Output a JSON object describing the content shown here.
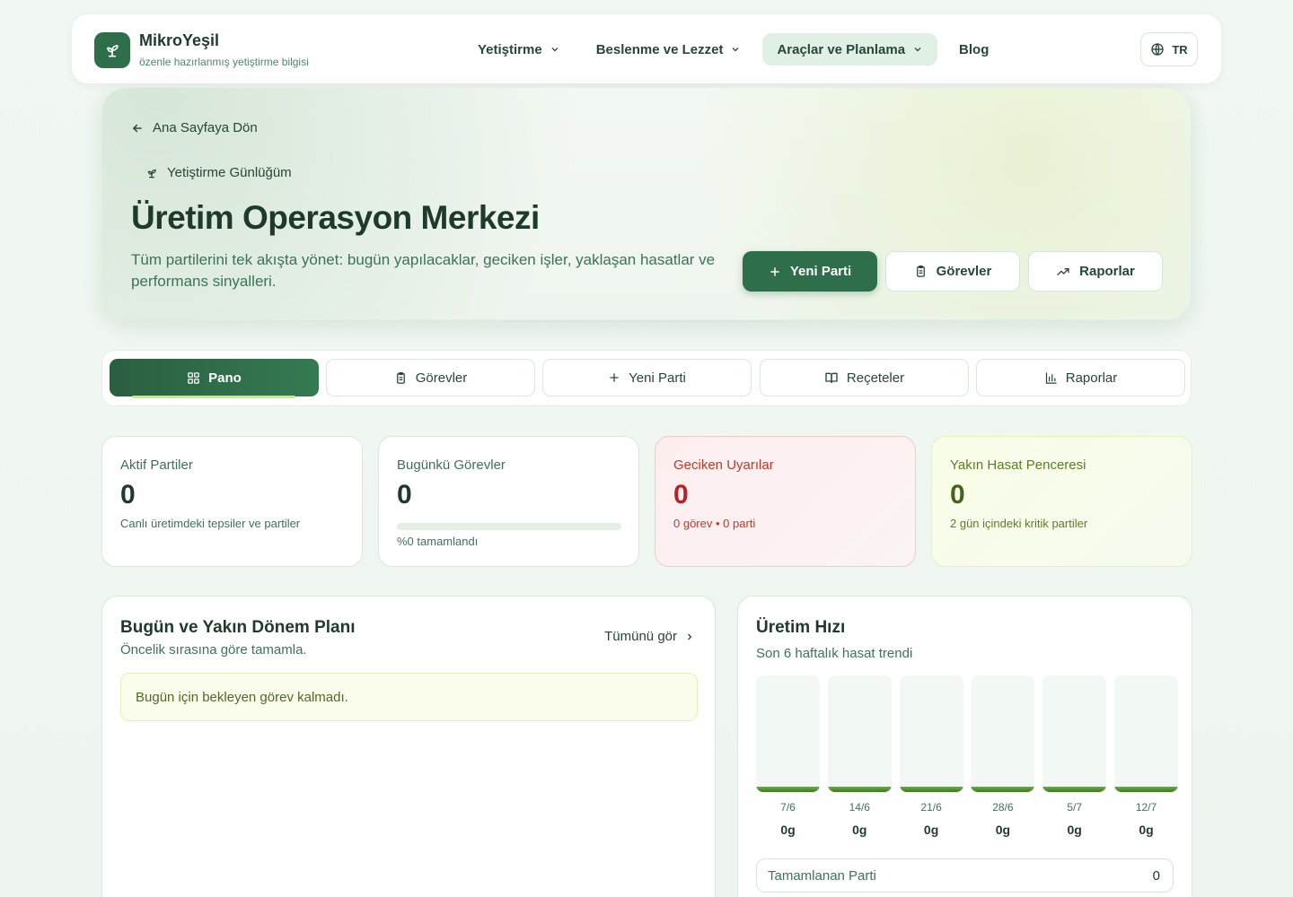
{
  "brand": {
    "name": "MikroYeşil",
    "tagline": "özenle hazırlanmış yetiştirme bilgisi"
  },
  "nav": {
    "items": [
      {
        "label": "Yetiştirme"
      },
      {
        "label": "Beslenme ve Lezzet"
      },
      {
        "label": "Araçlar ve Planlama"
      },
      {
        "label": "Blog"
      }
    ],
    "language": "TR"
  },
  "hero": {
    "back_label": "Ana Sayfaya Dön",
    "breadcrumb": "Yetiştirme Günlüğüm",
    "title": "Üretim Operasyon Merkezi",
    "description": "Tüm partilerini tek akışta yönet: bugün yapılacaklar, geciken işler, yaklaşan hasatlar ve performans sinyalleri.",
    "buttons": {
      "new_batch": "Yeni Parti",
      "tasks": "Görevler",
      "reports": "Raporlar"
    }
  },
  "tabs": [
    {
      "label": "Pano"
    },
    {
      "label": "Görevler"
    },
    {
      "label": "Yeni Parti"
    },
    {
      "label": "Reçeteler"
    },
    {
      "label": "Raporlar"
    }
  ],
  "stats": {
    "active": {
      "label": "Aktif Partiler",
      "value": "0",
      "sub": "Canlı üretimdeki tepsiler ve partiler"
    },
    "today": {
      "label": "Bugünkü Görevler",
      "value": "0",
      "sub": "%0 tamamlandı",
      "progress": 0
    },
    "overdue": {
      "label": "Geciken Uyarılar",
      "value": "0",
      "sub": "0 görev • 0 parti"
    },
    "harvest": {
      "label": "Yakın Hasat Penceresi",
      "value": "0",
      "sub": "2 gün içindeki kritik partiler"
    }
  },
  "plan": {
    "title": "Bugün ve Yakın Dönem Planı",
    "subtitle": "Öncelik sırasına göre tamamla.",
    "see_all": "Tümünü gör",
    "empty": "Bugün için bekleyen görev kalmadı."
  },
  "speed": {
    "title": "Üretim Hızı",
    "subtitle": "Son 6 haftalık hasat trendi",
    "summary_label": "Tamamlanan Parti",
    "summary_value": "0"
  },
  "chart_data": {
    "type": "bar",
    "categories": [
      "7/6",
      "14/6",
      "21/6",
      "28/6",
      "5/7",
      "12/7"
    ],
    "values": [
      0,
      0,
      0,
      0,
      0,
      0
    ],
    "value_labels": [
      "0g",
      "0g",
      "0g",
      "0g",
      "0g",
      "0g"
    ],
    "title": "Üretim Hızı",
    "xlabel": "",
    "ylabel": "",
    "grid": false
  },
  "colors": {
    "primary": "#2f6e4a",
    "accent_lime": "#c8ef7e",
    "danger": "#b72323"
  }
}
